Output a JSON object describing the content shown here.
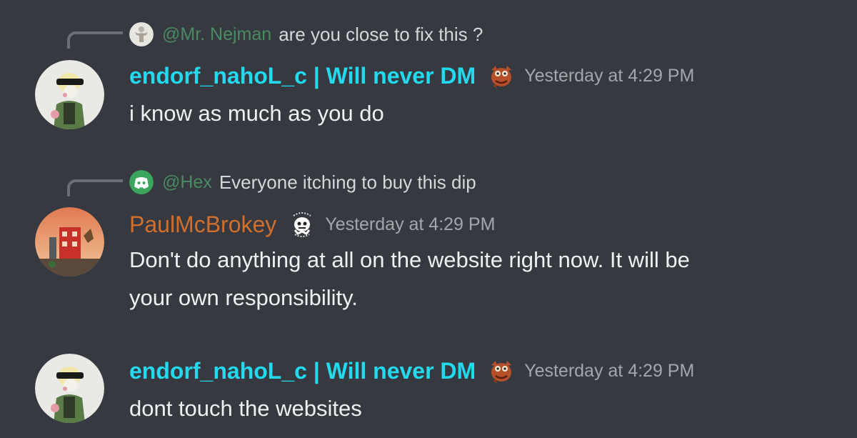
{
  "messages": [
    {
      "reply": {
        "mention": "@Mr. Nejman",
        "text": "are you close to fix this ?",
        "avatar_icon": "statue-avatar-icon"
      },
      "author": "endorf_nahoL_c | Will never DM",
      "author_color": "#22d9ee",
      "role_icon": "cartoon-character-icon",
      "timestamp": "Yesterday at 4:29 PM",
      "lines": [
        "i know as much as you do"
      ]
    },
    {
      "reply": {
        "mention": "@Hex",
        "text": "Everyone itching to buy this dip",
        "avatar_icon": "discord-logo-icon"
      },
      "author": "PaulMcBrokey",
      "author_color": "#d36f2c",
      "role_icon": "ghost-badge-icon",
      "timestamp": "Yesterday at 4:29 PM",
      "lines": [
        "Don't do anything at all on the website right now. It will be",
        "your own responsibility."
      ]
    },
    {
      "author": "endorf_nahoL_c | Will never DM",
      "author_color": "#22d9ee",
      "role_icon": "cartoon-character-icon",
      "timestamp": "Yesterday at 4:29 PM",
      "lines": [
        "dont touch the websites"
      ]
    }
  ],
  "colors": {
    "background": "#36393f",
    "mention": "#4a8a62",
    "reply_line": "#6b6e73"
  }
}
